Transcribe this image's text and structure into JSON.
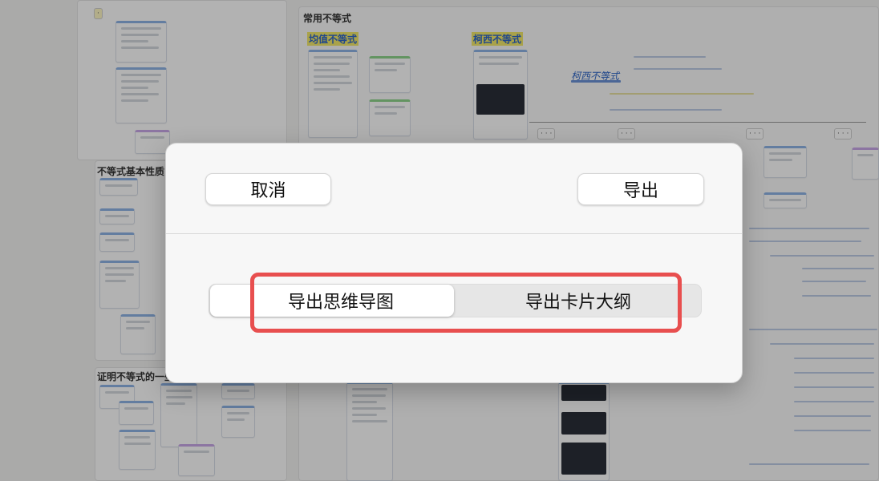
{
  "background": {
    "section_common": "常用不等式",
    "section_basic": "不等式基本性质",
    "section_methods": "证明不等式的一些方法",
    "heading_weighted": "均值不等式",
    "heading_cauchy": "柯西不等式",
    "handwritten_title": "柯西不等式"
  },
  "dialog": {
    "cancel_label": "取消",
    "export_label": "导出",
    "segments": [
      {
        "label": "导出思维导图",
        "selected": true
      },
      {
        "label": "导出卡片大纲",
        "selected": false
      }
    ]
  },
  "colors": {
    "highlight_border": "#e84f4f",
    "dialog_bg": "#f7f7f7",
    "segment_track": "#e6e6e6"
  }
}
